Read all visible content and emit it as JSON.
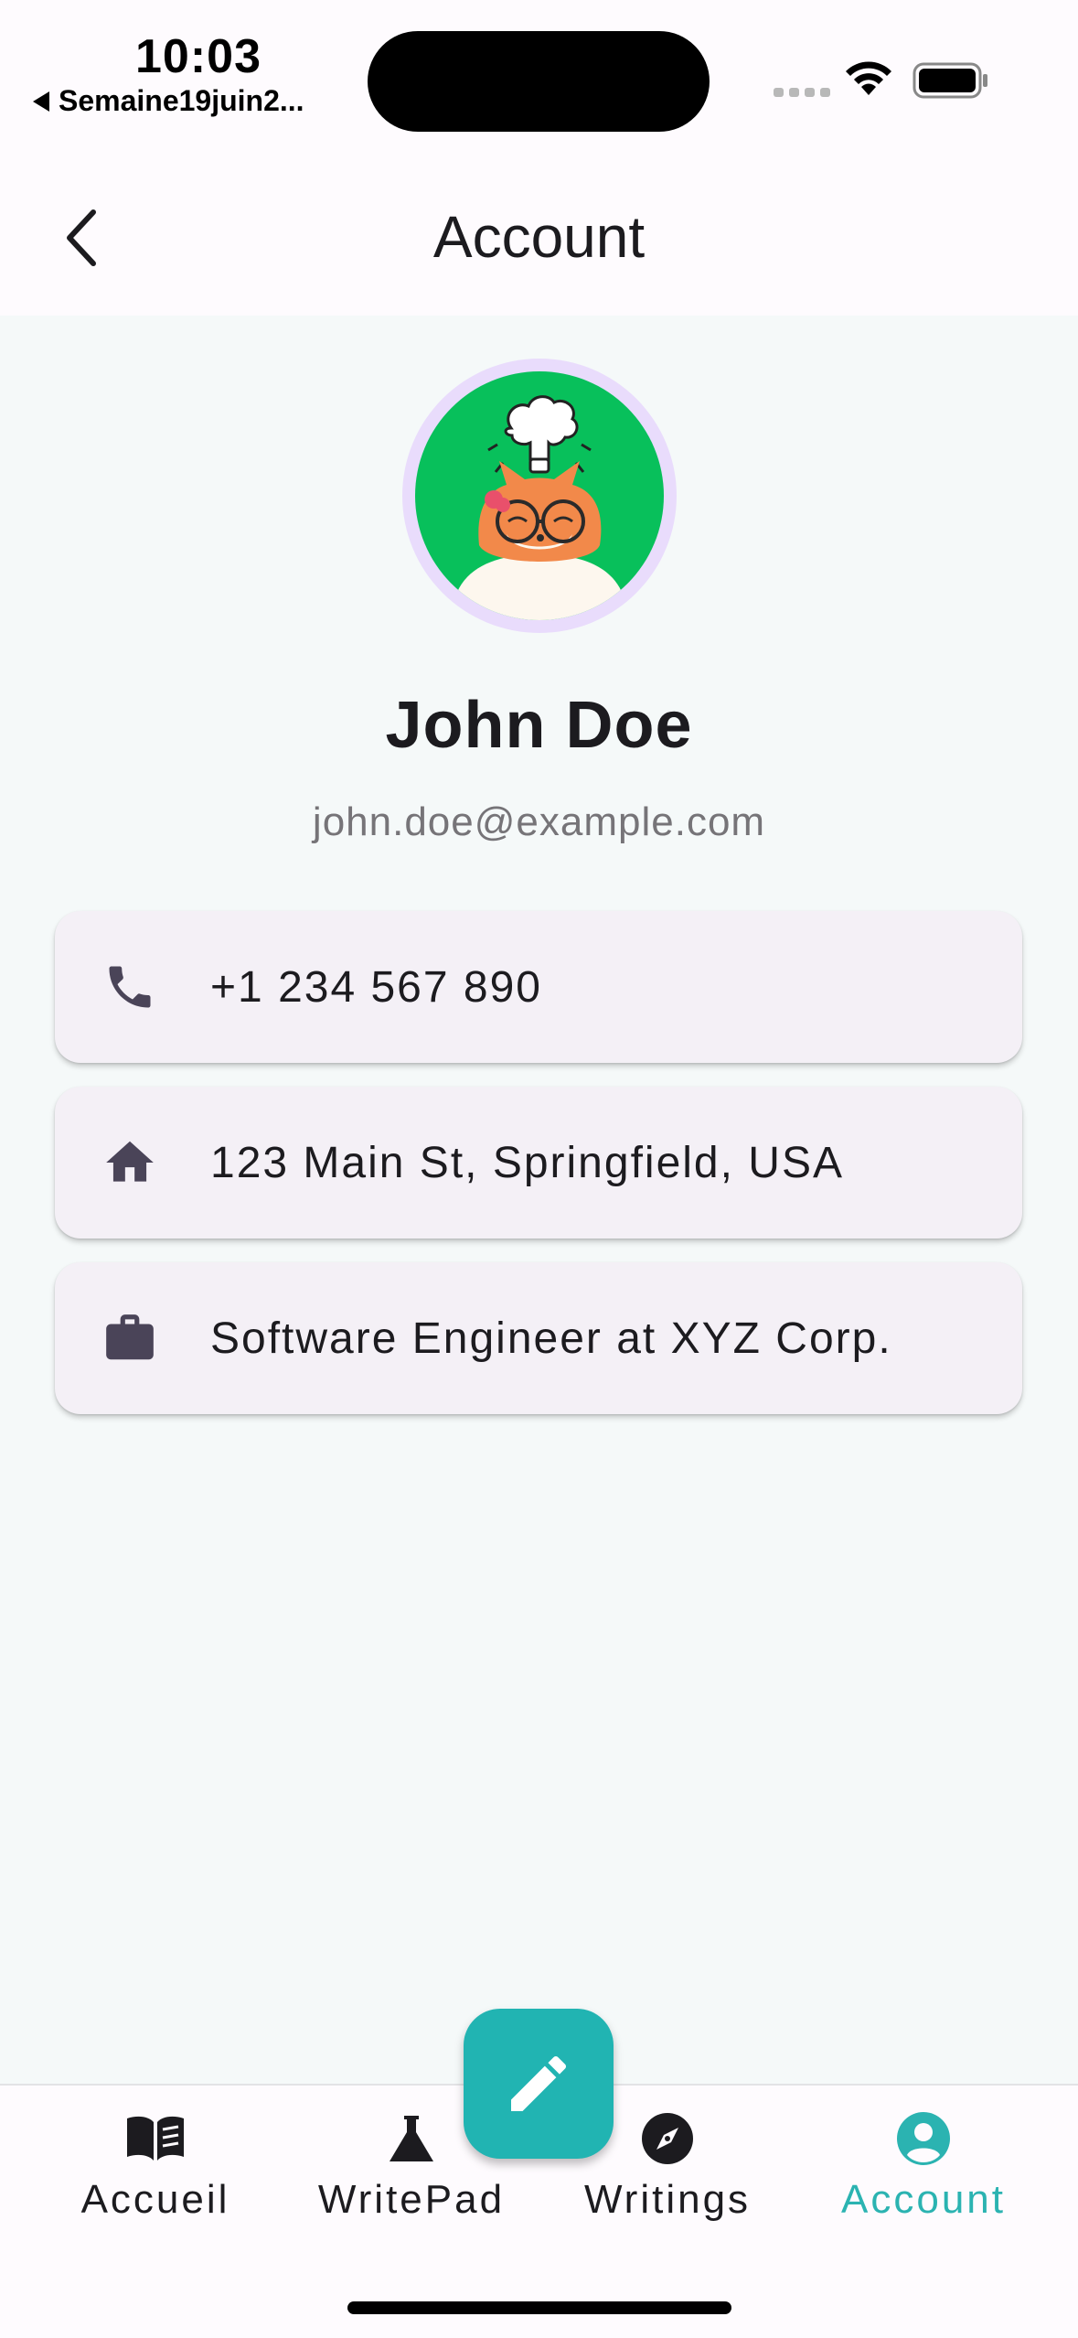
{
  "status_bar": {
    "time": "10:03",
    "back_app": "Semaine19juin2..."
  },
  "app_bar": {
    "title": "Account",
    "back_icon": "chevron-left-icon"
  },
  "profile": {
    "name": "John Doe",
    "email": "john.doe@example.com",
    "avatar": "fox-lightbulb-avatar"
  },
  "info_cards": [
    {
      "icon": "phone-icon",
      "text": "+1 234 567 890"
    },
    {
      "icon": "home-icon",
      "text": "123 Main St, Springfield, USA"
    },
    {
      "icon": "briefcase-icon",
      "text": "Software Engineer at XYZ Corp."
    }
  ],
  "bottom_nav": {
    "items": [
      {
        "label": "Accueil",
        "icon": "book-icon"
      },
      {
        "label": "WritePad",
        "icon": "flask-icon"
      },
      {
        "label": "Writings",
        "icon": "compass-icon"
      },
      {
        "label": "Account",
        "icon": "account-circle-icon",
        "active": true
      }
    ],
    "fab_icon": "pencil-icon"
  },
  "colors": {
    "accent": "#21b4b2",
    "active_nav": "#2bb3b1",
    "avatar_bg": "#08c05b",
    "avatar_ring": "#e9dcfc",
    "card_bg": "#f4f0f6",
    "page_bg": "#f5f9f9"
  }
}
